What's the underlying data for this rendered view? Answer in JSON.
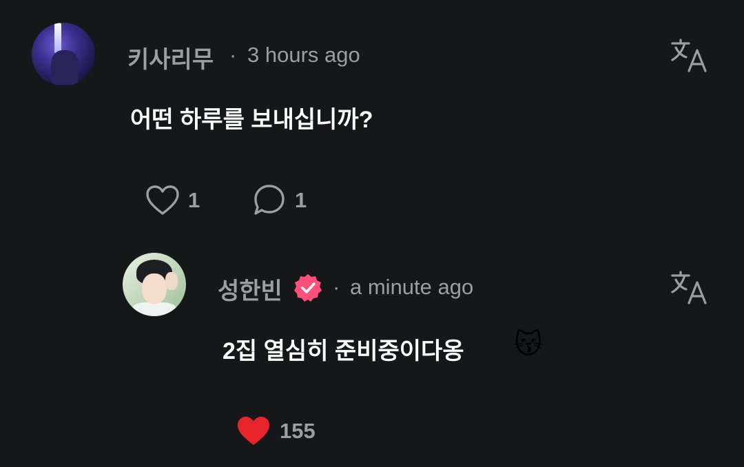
{
  "comments": [
    {
      "username": "키사리무",
      "separator": "·",
      "time": "3 hours ago",
      "text": "어떤 하루를 보내십니까?",
      "likes": "1",
      "replies": "1",
      "liked": false
    }
  ],
  "reply": {
    "username": "성한빈",
    "verified": true,
    "separator": "·",
    "time": "a minute ago",
    "text": "2집 열심히 준비중이다옹",
    "emoji": "😽",
    "likes": "155",
    "liked": true
  },
  "icons": {
    "translate": "translate-icon",
    "like": "heart-icon",
    "reply": "comment-bubble-icon",
    "verified": "verified-badge-icon"
  },
  "colors": {
    "background": "#161718",
    "muted_text": "#9b9fa4",
    "primary_text": "#ffffff",
    "like_active": "#e8242b",
    "verified_badge": "#ff4f7b"
  }
}
